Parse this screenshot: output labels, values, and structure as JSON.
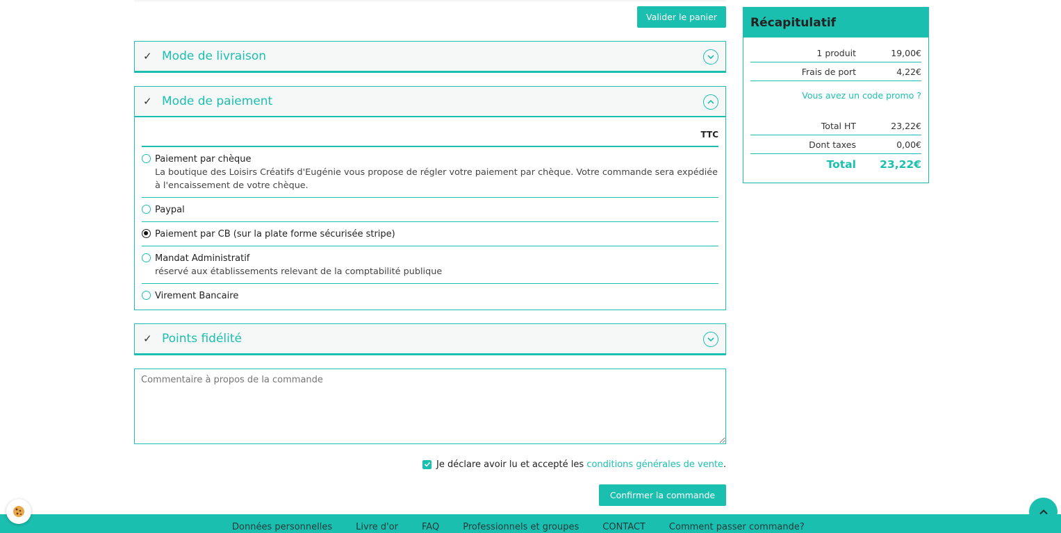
{
  "toolbar": {
    "validate_cart_label": "Valider le panier"
  },
  "sections": {
    "delivery": {
      "title": "Mode de livraison"
    },
    "payment": {
      "title": "Mode de paiement",
      "price_mode": "TTC",
      "options": [
        {
          "label": "Paiement par chèque",
          "description": "La boutique des Loisirs Créatifs d'Eugénie vous propose de régler votre paiement par chèque. Votre commande sera expédiée à l'encaissement de votre chèque.",
          "selected": false
        },
        {
          "label": "Paypal",
          "description": "",
          "selected": false
        },
        {
          "label": "Paiement par CB (sur la plate forme sécurisée stripe)",
          "description": "",
          "selected": true
        },
        {
          "label": "Mandat Administratif",
          "description": "réservé aux établissements relevant de la comptabilité publique",
          "selected": false
        },
        {
          "label": "Virement Bancaire",
          "description": "",
          "selected": false
        }
      ]
    },
    "loyalty": {
      "title": "Points fidélité"
    }
  },
  "comment": {
    "placeholder": "Commentaire à propos de la commande"
  },
  "terms": {
    "text": "Je déclare avoir lu et accepté les",
    "link": "conditions générales de vente",
    "suffix": ".",
    "checked": true
  },
  "confirm_label": "Confirmer la commande",
  "summary": {
    "title": "Récapitulatif",
    "products_label": "1 produit",
    "products_value": "19,00€",
    "shipping_label": "Frais de port",
    "shipping_value": "4,22€",
    "promo_link": "Vous avez un code promo ?",
    "total_ht_label": "Total HT",
    "total_ht_value": "23,22€",
    "taxes_label": "Dont taxes",
    "taxes_value": "0,00€",
    "total_label": "Total",
    "total_value": "23,22€"
  },
  "footer": {
    "links": [
      "Données personnelles",
      "Livre d'or",
      "FAQ",
      "Professionnels et groupes",
      "CONTACT",
      "Comment passer commande?"
    ]
  },
  "colors": {
    "accent": "#1bbfaf"
  }
}
